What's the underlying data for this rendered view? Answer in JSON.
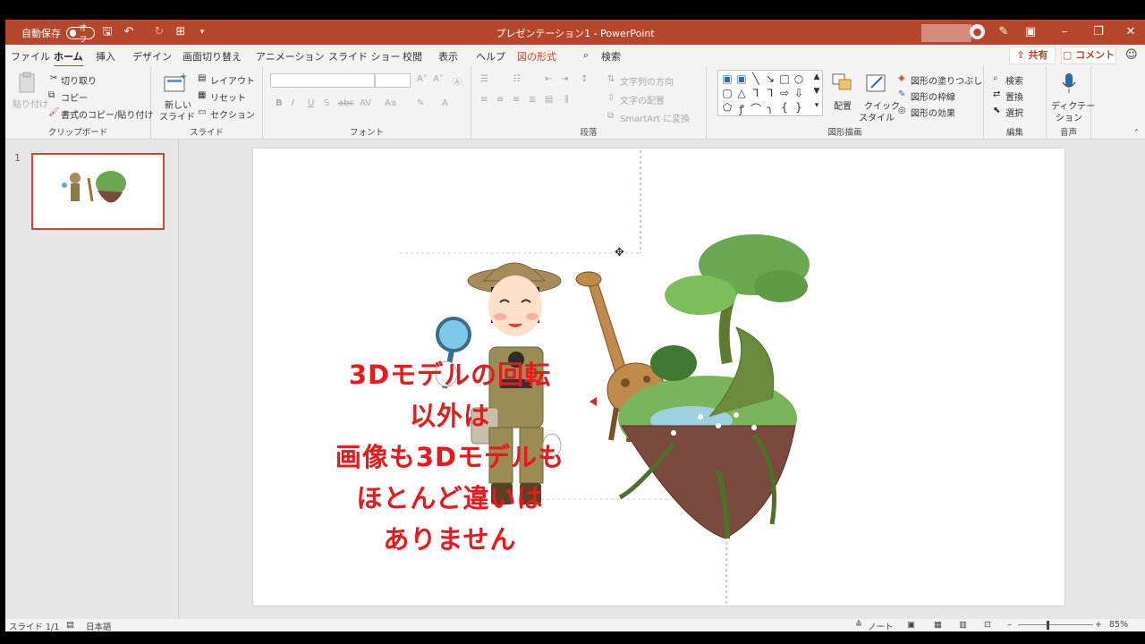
{
  "titlebar": {
    "autosave_label": "自動保存",
    "autosave_state": "オフ",
    "document_title": "プレゼンテーション1  -  PowerPoint"
  },
  "tabs": [
    "ファイル",
    "ホーム",
    "挿入",
    "デザイン",
    "画面切り替え",
    "アニメーション",
    "スライド ショー",
    "校閲",
    "表示",
    "ヘルプ",
    "図の形式"
  ],
  "search_label": "検索",
  "share_label": "共有",
  "comment_label": "コメント",
  "ribbon": {
    "clipboard": {
      "paste": "貼り付け",
      "cut": "切り取り",
      "copy": "コピー",
      "format_painter": "書式のコピー/貼り付け",
      "label": "クリップボード"
    },
    "slides": {
      "new_slide": "新しい",
      "new_slide2": "スライド",
      "layout": "レイアウト",
      "reset": "リセット",
      "section": "セクション",
      "label": "スライド"
    },
    "font": {
      "label": "フォント"
    },
    "paragraph": {
      "text_direction": "文字列の方向",
      "align_text": "文字の配置",
      "smartart": "SmartArt に変換",
      "label": "段落"
    },
    "drawing": {
      "arrange": "配置",
      "quick_styles": "クイック",
      "quick_styles2": "スタイル",
      "fill": "図形の塗りつぶし",
      "outline": "図形の枠線",
      "effects": "図形の効果",
      "label": "図形描画"
    },
    "editing": {
      "find": "検索",
      "replace": "置換",
      "select": "選択",
      "label": "編集"
    },
    "voice": {
      "dictate": "ディクテー",
      "dictate2": "ション",
      "label": "音声"
    }
  },
  "thumbnail": {
    "number": "1"
  },
  "slide": {
    "caption_lines": [
      "3Dモデルの回転",
      "以外は",
      "画像も3Dモデルも",
      "ほとんど違いは",
      "ありません"
    ]
  },
  "status": {
    "slide_info": "スライド 1/1",
    "language": "日本語",
    "notes": "ノート",
    "zoom": "85%"
  },
  "colors": {
    "accent": "#b7472a",
    "caption": "#e8191b"
  }
}
